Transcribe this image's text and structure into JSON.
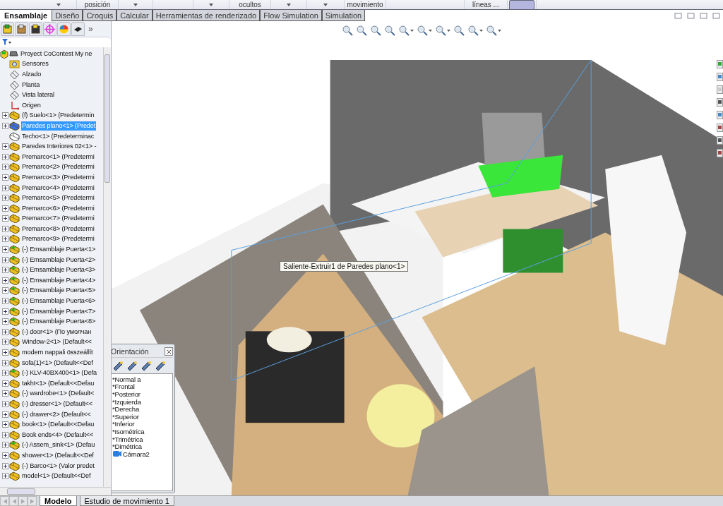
{
  "ribbon": [
    {
      "kind": "dropdown"
    },
    {
      "kind": "label",
      "text": "posición"
    },
    {
      "kind": "dropdown"
    },
    {
      "kind": "gap"
    },
    {
      "kind": "dropdown"
    },
    {
      "kind": "label",
      "text": "ocultos"
    },
    {
      "kind": "dropdown"
    },
    {
      "kind": "dropdown"
    },
    {
      "kind": "label",
      "text": "movimiento"
    },
    {
      "kind": "gap"
    },
    {
      "kind": "label",
      "text": "líneas ..."
    },
    {
      "kind": "button"
    }
  ],
  "tabs": [
    {
      "label": "Ensamblaje",
      "selected": true
    },
    {
      "label": "Diseño",
      "selected": false
    },
    {
      "label": "Croquis",
      "selected": false
    },
    {
      "label": "Calcular",
      "selected": false
    },
    {
      "label": "Herramientas de renderizado",
      "selected": false
    },
    {
      "label": "Flow Simulation",
      "selected": false
    },
    {
      "label": "Simulation",
      "selected": false
    }
  ],
  "panel_more": "»",
  "tree": [
    {
      "label": "Proyect CoContest  My ne",
      "kind": "root",
      "children": [
        {
          "label": "Sensores",
          "kind": "sensor",
          "expandable": false,
          "selected": false
        },
        {
          "label": "Alzado",
          "kind": "plane",
          "expandable": false,
          "selected": false
        },
        {
          "label": "Planta",
          "kind": "plane",
          "expandable": false,
          "selected": false
        },
        {
          "label": "Vista lateral",
          "kind": "plane",
          "expandable": false,
          "selected": false
        },
        {
          "label": "Origen",
          "kind": "origin",
          "expandable": false,
          "selected": false
        },
        {
          "label": "(f) Suelo<1> (Predetermin",
          "kind": "assembly",
          "expandable": true,
          "selected": false
        },
        {
          "label": "Paredes plano<1> (Predet",
          "kind": "part",
          "expandable": true,
          "selected": true
        },
        {
          "label": "Techo<1> (Predeterminac",
          "kind": "hidden",
          "expandable": false,
          "selected": false
        },
        {
          "label": "Paredes Interiores 02<1> -",
          "kind": "assembly",
          "expandable": true,
          "selected": false
        },
        {
          "label": "Premarco<1> (Predetermi",
          "kind": "assembly",
          "expandable": true,
          "selected": false
        },
        {
          "label": "Premarco<2> (Predetermi",
          "kind": "assembly",
          "expandable": true,
          "selected": false
        },
        {
          "label": "Premarco<3> (Predetermi",
          "kind": "assembly",
          "expandable": true,
          "selected": false
        },
        {
          "label": "Premarco<4> (Predetermi",
          "kind": "assembly",
          "expandable": true,
          "selected": false
        },
        {
          "label": "Premarco<5> (Predetermi",
          "kind": "assembly",
          "expandable": true,
          "selected": false
        },
        {
          "label": "Premarco<6> (Predetermi",
          "kind": "assembly",
          "expandable": true,
          "selected": false
        },
        {
          "label": "Premarco<7> (Predetermi",
          "kind": "assembly",
          "expandable": true,
          "selected": false
        },
        {
          "label": "Premarco<8> (Predetermi",
          "kind": "assembly",
          "expandable": true,
          "selected": false
        },
        {
          "label": "Premarco<9> (Predetermi",
          "kind": "assembly",
          "expandable": true,
          "selected": false
        },
        {
          "label": "(-) Emsamblaje Puerta<1>",
          "kind": "subassembly",
          "expandable": true,
          "selected": false
        },
        {
          "label": "(-) Emsamblaje Puerta<2>",
          "kind": "subassembly",
          "expandable": true,
          "selected": false
        },
        {
          "label": "(-) Emsamblaje Puerta<3>",
          "kind": "subassembly",
          "expandable": true,
          "selected": false
        },
        {
          "label": "(-) Emsamblaje Puerta<4>",
          "kind": "subassembly",
          "expandable": true,
          "selected": false
        },
        {
          "label": "(-) Emsamblaje Puerta<5>",
          "kind": "subassembly",
          "expandable": true,
          "selected": false
        },
        {
          "label": "(-) Emsamblaje Puerta<6>",
          "kind": "subassembly",
          "expandable": true,
          "selected": false
        },
        {
          "label": "(-) Emsamblaje Puerta<7>",
          "kind": "subassembly",
          "expandable": true,
          "selected": false
        },
        {
          "label": "(-) Emsamblaje Puerta<8>",
          "kind": "subassembly",
          "expandable": true,
          "selected": false
        },
        {
          "label": "(-) door<1> (По умолчан",
          "kind": "assembly",
          "expandable": true,
          "selected": false
        },
        {
          "label": "Window-2<1> (Default<<",
          "kind": "assembly",
          "expandable": true,
          "selected": false
        },
        {
          "label": "modern nappali összeállít",
          "kind": "assembly",
          "expandable": true,
          "selected": false
        },
        {
          "label": "sofa(1)<1> (Default<<Def",
          "kind": "assembly",
          "expandable": true,
          "selected": false
        },
        {
          "label": "(-) KLV-40BX400<1> (Defa",
          "kind": "subassembly",
          "expandable": true,
          "selected": false
        },
        {
          "label": "takht<1> (Default<<Defau",
          "kind": "assembly",
          "expandable": true,
          "selected": false
        },
        {
          "label": "(-) wardrobe<1> (Default<",
          "kind": "assembly",
          "expandable": true,
          "selected": false
        },
        {
          "label": "(-) dresser<1> (Default<<",
          "kind": "assembly",
          "expandable": true,
          "selected": false
        },
        {
          "label": "(-) drawer<2> (Default<<",
          "kind": "assembly",
          "expandable": true,
          "selected": false
        },
        {
          "label": "book<1> (Default<<Defau",
          "kind": "assembly",
          "expandable": true,
          "selected": false
        },
        {
          "label": "Book ends<4> (Default<<",
          "kind": "assembly",
          "expandable": true,
          "selected": false
        },
        {
          "label": "(-) Assem_sink<1> (Defau",
          "kind": "subassembly",
          "expandable": true,
          "selected": false
        },
        {
          "label": "shower<1> (Default<<Def",
          "kind": "assembly",
          "expandable": true,
          "selected": false
        },
        {
          "label": "(-) Barco<1> (Valor predet",
          "kind": "assembly",
          "expandable": true,
          "selected": false
        },
        {
          "label": "model<1> (Default<<Def",
          "kind": "assembly",
          "expandable": true,
          "selected": false
        }
      ]
    }
  ],
  "viewport": {
    "tooltip": "Saliente-Extruir1 de Paredes plano<1>"
  },
  "orientation": {
    "title": "Orientación",
    "views": [
      {
        "label": "*Normal a",
        "kind": "view"
      },
      {
        "label": "*Frontal",
        "kind": "view"
      },
      {
        "label": "*Posterior",
        "kind": "view"
      },
      {
        "label": "*Izquierda",
        "kind": "view"
      },
      {
        "label": "*Derecha",
        "kind": "view"
      },
      {
        "label": "*Superior",
        "kind": "view"
      },
      {
        "label": "*Inferior",
        "kind": "view"
      },
      {
        "label": "*Isométrica",
        "kind": "view"
      },
      {
        "label": "*Trimétrica",
        "kind": "view"
      },
      {
        "label": "*Dimétrica",
        "kind": "view"
      },
      {
        "label": "Cámara2",
        "kind": "camera"
      }
    ]
  },
  "bottom_tabs": [
    {
      "label": "Modelo",
      "selected": true
    },
    {
      "label": "Estudio de movimiento 1",
      "selected": false
    }
  ]
}
